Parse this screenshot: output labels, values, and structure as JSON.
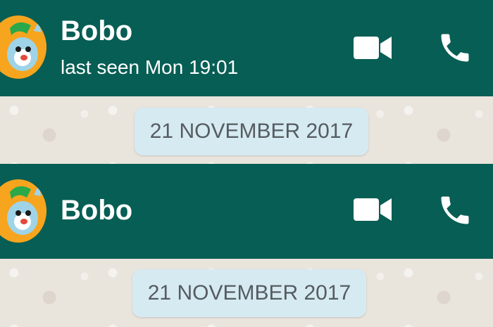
{
  "colors": {
    "header": "#075e54",
    "date_pill": "#d6eaf2",
    "avatar_bg": "#f7a51e"
  },
  "top_chat": {
    "contact_name": "Bobo",
    "status": "last seen Mon 19:01",
    "date_label": "21 NOVEMBER 2017",
    "icons": [
      "video-call-icon",
      "phone-call-icon"
    ]
  },
  "bottom_chat": {
    "contact_name": "Bobo",
    "date_label": "21 NOVEMBER 2017",
    "icons": [
      "video-call-icon",
      "phone-call-icon"
    ]
  }
}
